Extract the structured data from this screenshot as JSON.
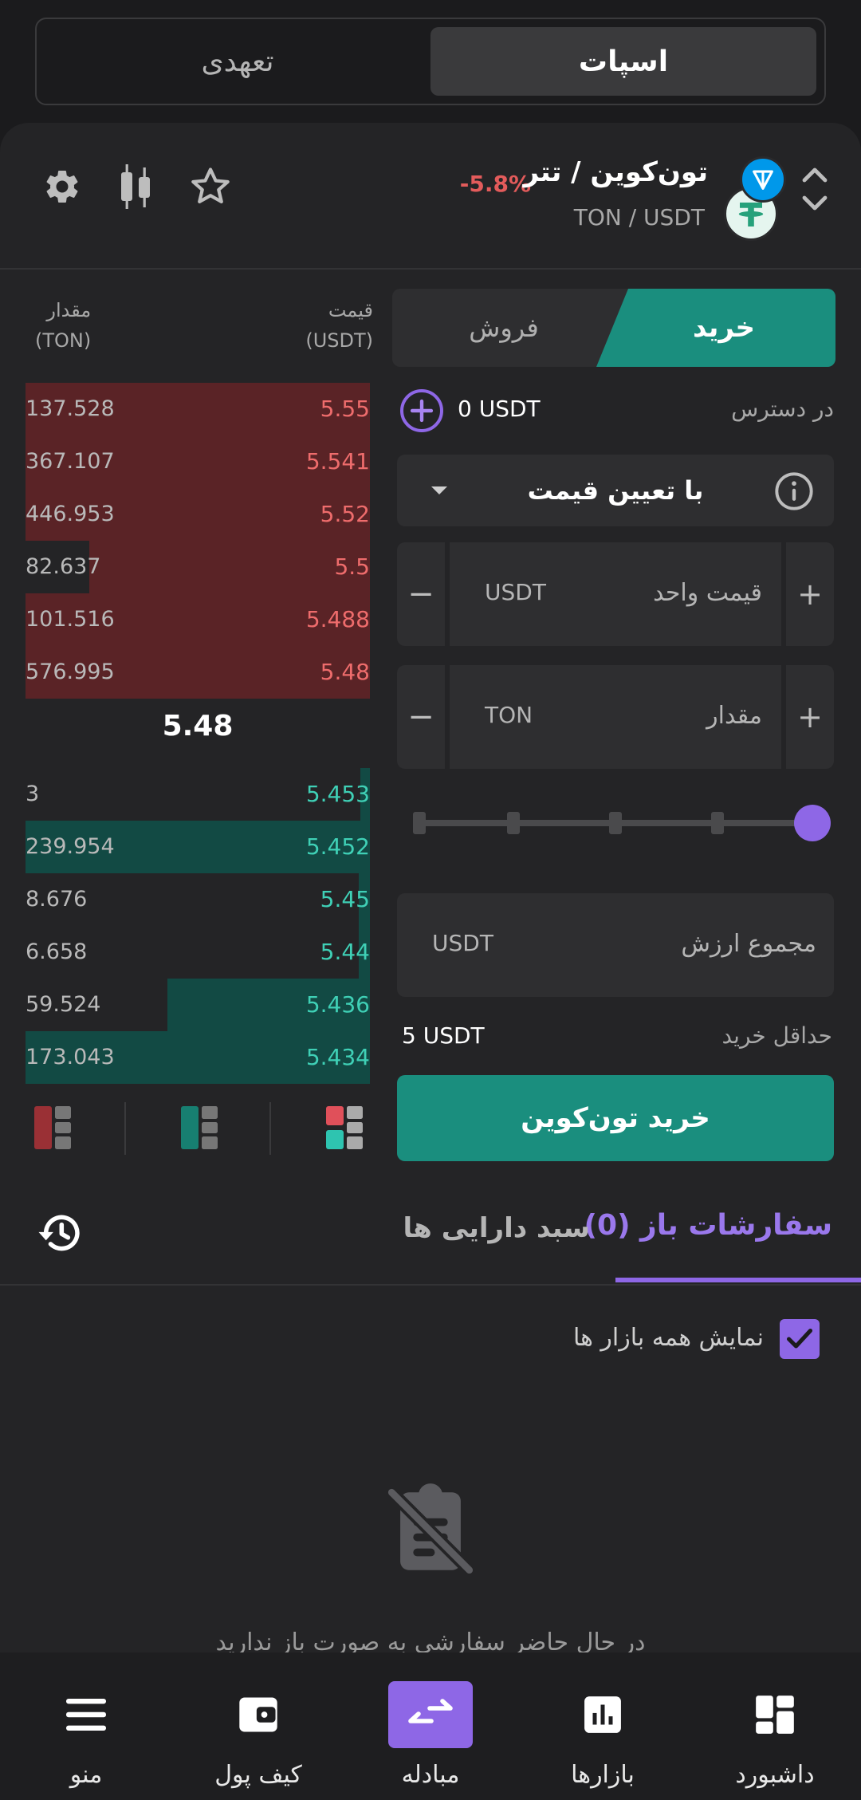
{
  "top_tabs": {
    "spot": "اسپات",
    "margin": "تعهدی"
  },
  "pair": {
    "title": "تون‌کوین / تتر",
    "symbol": "TON / USDT",
    "change": "-5.8%"
  },
  "icons": {
    "settings": "gear-icon",
    "chart": "candlestick-icon",
    "favorite": "star-icon",
    "sort": "chevron-updown-icon"
  },
  "orderbook": {
    "qty_header": "مقدار",
    "qty_unit": "(TON)",
    "price_header": "قیمت",
    "price_unit": "(USDT)",
    "asks": [
      {
        "qty": "137.528",
        "price": "5.55"
      },
      {
        "qty": "367.107",
        "price": "5.541"
      },
      {
        "qty": "446.953",
        "price": "5.52"
      },
      {
        "qty": "82.637",
        "price": "5.5"
      },
      {
        "qty": "101.516",
        "price": "5.488"
      },
      {
        "qty": "576.995",
        "price": "5.48"
      }
    ],
    "last_price": "5.48",
    "bids": [
      {
        "qty": "3",
        "price": "5.453"
      },
      {
        "qty": "239.954",
        "price": "5.452"
      },
      {
        "qty": "8.676",
        "price": "5.45"
      },
      {
        "qty": "6.658",
        "price": "5.44"
      },
      {
        "qty": "59.524",
        "price": "5.436"
      },
      {
        "qty": "173.043",
        "price": "5.434"
      }
    ]
  },
  "form": {
    "buy_tab": "خرید",
    "sell_tab": "فروش",
    "available_label": "در دسترس",
    "available_value": "0 USDT",
    "order_type": "با تعیین قیمت",
    "price_label": "قیمت واحد",
    "price_unit": "USDT",
    "amount_label": "مقدار",
    "amount_unit": "TON",
    "total_label": "مجموع ارزش",
    "total_unit": "USDT",
    "min_label": "حداقل خرید",
    "min_value": "5 USDT",
    "buy_button": "خرید تون‌کوین",
    "slider_fraction": 1.0
  },
  "orders": {
    "tab_open": "سفارشات باز (0)",
    "tab_assets": "سبد دارایی ها",
    "show_all_label": "نمایش همه بازار ها",
    "empty_text": "در حال حاضر سفارشی به صورت باز ندارید"
  },
  "nav": [
    {
      "label": "منو",
      "icon": "menu-icon"
    },
    {
      "label": "کیف پول",
      "icon": "wallet-icon"
    },
    {
      "label": "مبادله",
      "icon": "exchange-icon"
    },
    {
      "label": "بازارها",
      "icon": "bar-chart-icon"
    },
    {
      "label": "داشبورد",
      "icon": "dashboard-icon"
    }
  ],
  "colors": {
    "accent": "#8e67e6",
    "buy": "#1a8e7e",
    "ask": "#ee6c6c",
    "bid": "#3fd0b6"
  }
}
